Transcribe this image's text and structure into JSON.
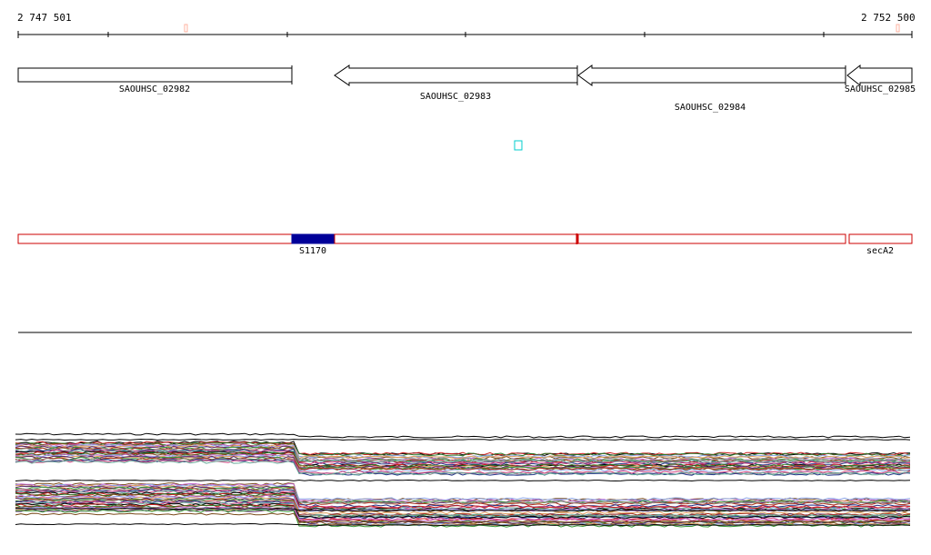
{
  "ruler": {
    "start_label": "2 747 501",
    "end_label": "2 752 500"
  },
  "genes": [
    {
      "label": "SAOUHSC_02982",
      "strand": "+"
    },
    {
      "label": "SAOUHSC_02983",
      "strand": "-"
    },
    {
      "label": "SAOUHSC_02984",
      "strand": "-"
    },
    {
      "label": "SAOUHSC_02985",
      "strand": "-"
    }
  ],
  "feature_track": {
    "segments": [
      {
        "label": "",
        "color": "#cc0000"
      },
      {
        "label": "S1170",
        "color": "#000099"
      },
      {
        "label": "",
        "color": "#cc0000"
      },
      {
        "label": "",
        "color": "#cc0000"
      },
      {
        "label": "secA2",
        "color": "#cc0000"
      }
    ]
  },
  "colors": {
    "gene_outline": "#000000",
    "feature_outline": "#cc0000",
    "feature_highlight": "#000099",
    "marker": "#00cccc",
    "ruler_tick_marker": "#ffb3a0"
  },
  "expression_profiles": {
    "palette": [
      "#000000",
      "#cc2222",
      "#2a7a2a",
      "#7a4a1a",
      "#c46ad1",
      "#8fa8e8",
      "#e0a060",
      "#5a2a6a",
      "#3a9a3a",
      "#aa3322",
      "#999999",
      "#223388",
      "#d04080",
      "#66aa99"
    ]
  }
}
